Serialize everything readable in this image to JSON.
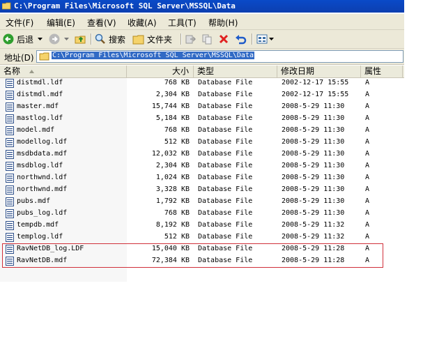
{
  "window": {
    "title": "C:\\Program Files\\Microsoft SQL Server\\MSSQL\\Data"
  },
  "menu": [
    {
      "label": "文件(F)"
    },
    {
      "label": "编辑(E)"
    },
    {
      "label": "查看(V)"
    },
    {
      "label": "收藏(A)"
    },
    {
      "label": "工具(T)"
    },
    {
      "label": "帮助(H)"
    }
  ],
  "toolbar": {
    "back_label": "后退",
    "search_label": "搜索",
    "folders_label": "文件夹"
  },
  "address": {
    "label": "地址(D)",
    "value": "C:\\Program Files\\Microsoft SQL Server\\MSSQL\\Data"
  },
  "columns": {
    "name": "名称",
    "size": "大小",
    "type": "类型",
    "modified": "修改日期",
    "attributes": "属性"
  },
  "files": [
    {
      "name": "distmdl.ldf",
      "size": "768 KB",
      "type": "Database File",
      "modified": "2002-12-17 15:55",
      "attr": "A"
    },
    {
      "name": "distmdl.mdf",
      "size": "2,304 KB",
      "type": "Database File",
      "modified": "2002-12-17 15:55",
      "attr": "A"
    },
    {
      "name": "master.mdf",
      "size": "15,744 KB",
      "type": "Database File",
      "modified": "2008-5-29 11:30",
      "attr": "A"
    },
    {
      "name": "mastlog.ldf",
      "size": "5,184 KB",
      "type": "Database File",
      "modified": "2008-5-29 11:30",
      "attr": "A"
    },
    {
      "name": "model.mdf",
      "size": "768 KB",
      "type": "Database File",
      "modified": "2008-5-29 11:30",
      "attr": "A"
    },
    {
      "name": "modellog.ldf",
      "size": "512 KB",
      "type": "Database File",
      "modified": "2008-5-29 11:30",
      "attr": "A"
    },
    {
      "name": "msdbdata.mdf",
      "size": "12,032 KB",
      "type": "Database File",
      "modified": "2008-5-29 11:30",
      "attr": "A"
    },
    {
      "name": "msdblog.ldf",
      "size": "2,304 KB",
      "type": "Database File",
      "modified": "2008-5-29 11:30",
      "attr": "A"
    },
    {
      "name": "northwnd.ldf",
      "size": "1,024 KB",
      "type": "Database File",
      "modified": "2008-5-29 11:30",
      "attr": "A"
    },
    {
      "name": "northwnd.mdf",
      "size": "3,328 KB",
      "type": "Database File",
      "modified": "2008-5-29 11:30",
      "attr": "A"
    },
    {
      "name": "pubs.mdf",
      "size": "1,792 KB",
      "type": "Database File",
      "modified": "2008-5-29 11:30",
      "attr": "A"
    },
    {
      "name": "pubs_log.ldf",
      "size": "768 KB",
      "type": "Database File",
      "modified": "2008-5-29 11:30",
      "attr": "A"
    },
    {
      "name": "tempdb.mdf",
      "size": "8,192 KB",
      "type": "Database File",
      "modified": "2008-5-29 11:32",
      "attr": "A"
    },
    {
      "name": "templog.ldf",
      "size": "512 KB",
      "type": "Database File",
      "modified": "2008-5-29 11:32",
      "attr": "A"
    },
    {
      "name": "RavNetDB_log.LDF",
      "size": "15,040 KB",
      "type": "Database File",
      "modified": "2008-5-29 11:28",
      "attr": "A"
    },
    {
      "name": "RavNetDB.mdf",
      "size": "72,384 KB",
      "type": "Database File",
      "modified": "2008-5-29 11:28",
      "attr": "A"
    }
  ],
  "colors": {
    "titlebar": "#0c3fb0",
    "chrome": "#ece9d8",
    "selection": "#316ac5",
    "highlight_box": "#d0303a"
  }
}
